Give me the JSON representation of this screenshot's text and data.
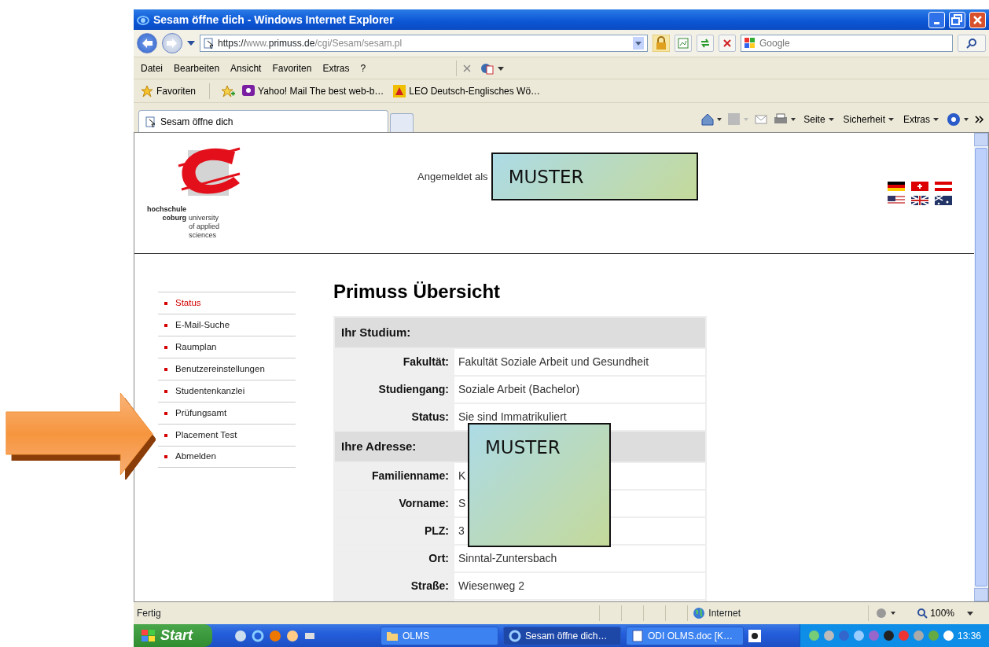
{
  "window": {
    "title": "Sesam öffne dich - Windows Internet Explorer"
  },
  "address_bar": {
    "url_parts": [
      {
        "text": "https://",
        "dim": false
      },
      {
        "text": "www.",
        "dim": true
      },
      {
        "text": "primuss.de",
        "dim": false
      },
      {
        "text": "/cgi/Sesam/sesam.pl",
        "dim": true
      }
    ]
  },
  "search": {
    "placeholder": "Google"
  },
  "menu": [
    "Datei",
    "Bearbeiten",
    "Ansicht",
    "Favoriten",
    "Extras",
    "?"
  ],
  "favorites_bar": {
    "label": "Favoriten",
    "links": [
      "Yahoo! Mail The best web-b…",
      "LEO Deutsch-Englisches Wö…"
    ]
  },
  "tabs": [
    {
      "label": "Sesam öffne dich",
      "selected": true
    }
  ],
  "command_bar": [
    "Seite",
    "Sicherheit",
    "Extras"
  ],
  "page": {
    "logo": {
      "name_lines": [
        "hochschule",
        "coburg"
      ],
      "tagline_lines": [
        "university",
        "of applied",
        "sciences"
      ]
    },
    "logged_in_label": "Angemeldet als",
    "user_stamp": "MUSTER",
    "nav": [
      {
        "label": "Status",
        "selected": true
      },
      {
        "label": "E-Mail-Suche",
        "selected": false
      },
      {
        "label": "Raumplan",
        "selected": false
      },
      {
        "label": "Benutzereinstellungen",
        "selected": false
      },
      {
        "label": "Studentenkanzlei",
        "selected": false
      },
      {
        "label": "Prüfungsamt",
        "selected": false
      },
      {
        "label": "Placement Test",
        "selected": false
      },
      {
        "label": "Abmelden",
        "selected": false
      }
    ],
    "heading": "Primuss Übersicht",
    "sections": [
      {
        "title": "Ihr Studium:",
        "rows": [
          {
            "label": "Fakultät:",
            "value": "Fakultät Soziale Arbeit und Gesundheit"
          },
          {
            "label": "Studiengang:",
            "value": "Soziale Arbeit (Bachelor)"
          },
          {
            "label": "Status:",
            "value": "Sie sind Immatrikuliert"
          }
        ]
      },
      {
        "title": "Ihre Adresse:",
        "rows": [
          {
            "label": "Familienname:",
            "value": "K"
          },
          {
            "label": "Vorname:",
            "value": "S"
          },
          {
            "label": "PLZ:",
            "value": "3"
          },
          {
            "label": "Ort:",
            "value": "Sinntal-Zuntersbach"
          },
          {
            "label": "Straße:",
            "value": "Wiesenweg 2"
          }
        ]
      }
    ],
    "overlay_stamp": "MUSTER"
  },
  "status_bar": {
    "text": "Fertig",
    "zone": "Internet",
    "zoom": "100%"
  },
  "taskbar": {
    "start": "Start",
    "tasks": [
      {
        "label": "OLMS",
        "selected": false
      },
      {
        "label": "Sesam öffne dich…",
        "selected": true
      },
      {
        "label": "ODI OLMS.doc [K…",
        "selected": false
      }
    ],
    "clock": "13:36"
  }
}
